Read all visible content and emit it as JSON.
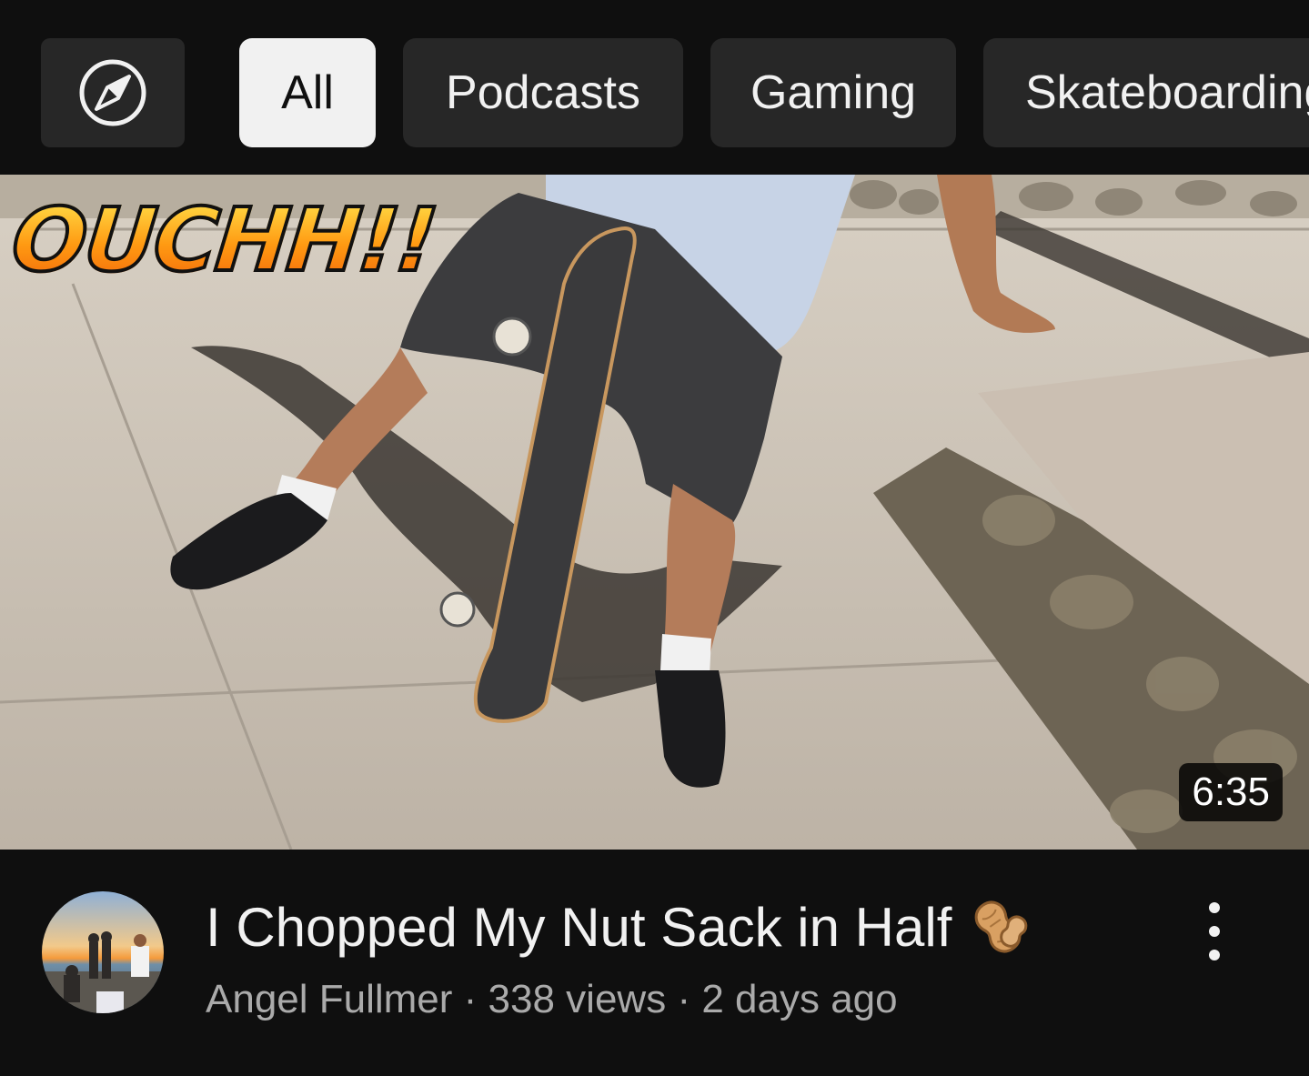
{
  "chips": {
    "explore_icon": "compass-icon",
    "items": [
      {
        "label": "All",
        "selected": true
      },
      {
        "label": "Podcasts",
        "selected": false
      },
      {
        "label": "Gaming",
        "selected": false
      },
      {
        "label": "Skateboarding",
        "selected": false
      }
    ]
  },
  "video": {
    "thumbnail_overlay_text": "OUCHH!!",
    "duration": "6:35",
    "title": "I Chopped My Nut Sack in Half",
    "title_emoji_icon": "peanut-icon",
    "channel": "Angel Fullmer",
    "views": "338 views",
    "age": "2 days ago",
    "separator": " · ",
    "more_icon": "more-vert-icon"
  },
  "colors": {
    "background": "#0f0f0f",
    "chip_bg": "#272727",
    "chip_active_bg": "#f1f1f1",
    "text_primary": "#f1f1f1",
    "text_secondary": "#aaaaaa"
  }
}
